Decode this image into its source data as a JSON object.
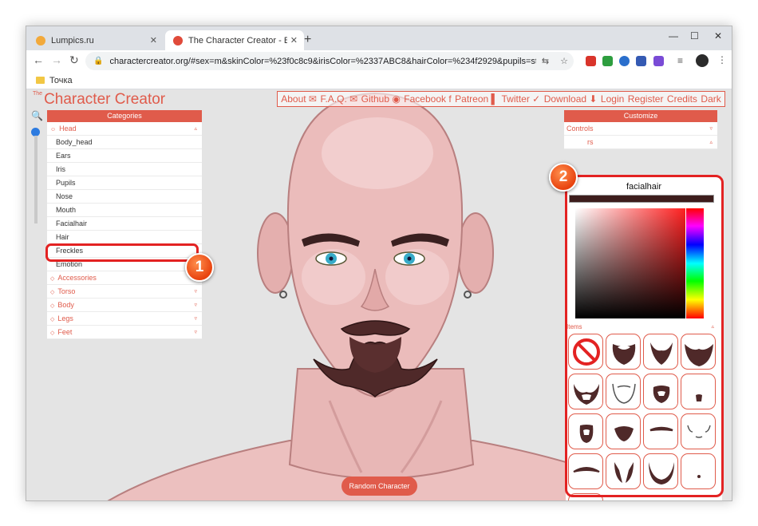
{
  "browser": {
    "tabs": [
      {
        "title": "Lumpics.ru",
        "favicon_color": "#f2a93b"
      },
      {
        "title": "The Character Creator - Build vis",
        "favicon_color": "#e04a3a"
      }
    ],
    "url": "charactercreator.org/#sex=m&skinColor=%23f0c8c9&irisColor=%2337ABC8&hairColor=%234f2929&pupils=star&ears=un...",
    "bookmark": "Точка",
    "ext_colors": [
      "#d9342b",
      "#2e9e3f",
      "#2a6fcc",
      "#355ab3",
      "#7a4bd6"
    ]
  },
  "site": {
    "logo_small": "The",
    "logo": "Character Creator",
    "nav": [
      {
        "label": "About",
        "icon": "mail-icon"
      },
      {
        "label": "F.A.Q.",
        "icon": "mail-icon"
      },
      {
        "label": "Github",
        "icon": "github-icon"
      },
      {
        "label": "Facebook",
        "icon": "facebook-icon"
      },
      {
        "label": "Patreon",
        "icon": "patreon-icon"
      },
      {
        "label": "Twitter",
        "icon": "twitter-icon"
      },
      {
        "label": "Download",
        "icon": "download-icon"
      },
      {
        "label": "Login",
        "icon": ""
      },
      {
        "label": "Register",
        "icon": ""
      },
      {
        "label": "Credits",
        "icon": ""
      },
      {
        "label": "Dark",
        "icon": ""
      }
    ],
    "accent": "#e05b4b"
  },
  "categories": {
    "header": "Categories",
    "head_label": "Head",
    "head_items": [
      "Body_head",
      "Ears",
      "Iris",
      "Pupils",
      "Nose",
      "Mouth",
      "Facialhair",
      "Hair",
      "Freckles",
      "Emotion"
    ],
    "other": [
      "Accessories",
      "Torso",
      "Body",
      "Legs",
      "Feet"
    ]
  },
  "customize": {
    "header": "Customize",
    "controls": "Controls",
    "colors_partial": "rs",
    "section_title": "facialhair",
    "current_color": "#3d1d1c",
    "items_label": "Items",
    "item_count": 17
  },
  "callouts": {
    "first": "1",
    "second": "2"
  },
  "random_button": "Random Character"
}
